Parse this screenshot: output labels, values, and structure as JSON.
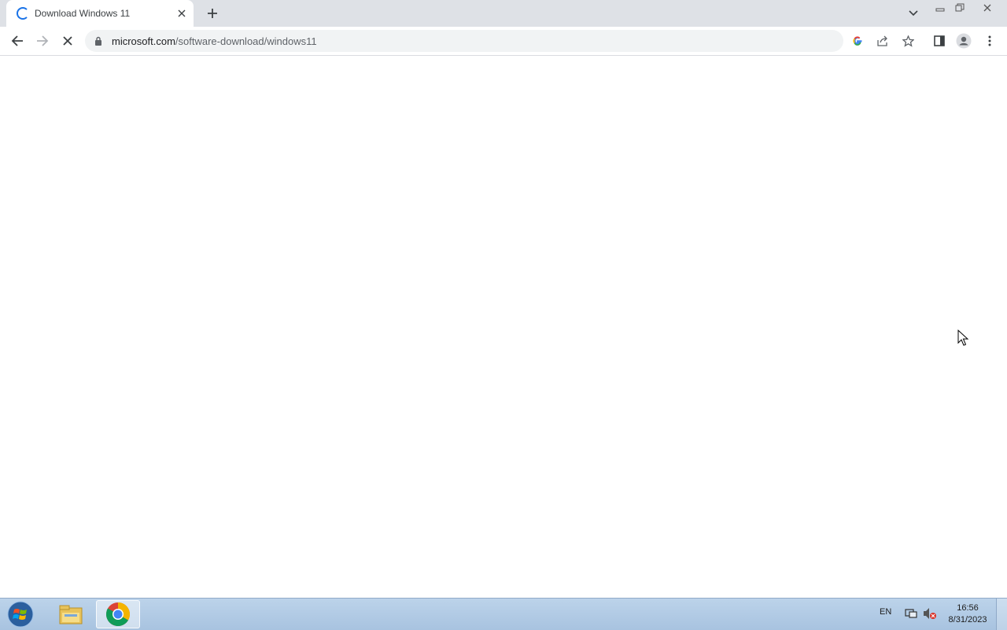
{
  "browser": {
    "tab": {
      "title": "Download Windows 11",
      "loading": true
    },
    "omnibox": {
      "url_host": "microsoft.com",
      "url_path": "/software-download/windows11"
    },
    "icons": {
      "tab_close": "close-icon",
      "new_tab": "plus-icon",
      "tab_search": "chevron-down-icon",
      "back": "arrow-left-icon",
      "forward": "arrow-right-icon",
      "reload": "stop-loading-icon",
      "lock": "lock-icon",
      "google": "google-icon",
      "share": "share-icon",
      "bookmark": "star-icon",
      "side_panel": "side-panel-icon",
      "profile": "profile-icon",
      "menu": "kebab-menu-icon"
    }
  },
  "taskbar": {
    "language": "EN",
    "clock_time": "16:56",
    "clock_date": "8/31/2023",
    "apps": [
      "Windows Explorer",
      "Google Chrome"
    ]
  },
  "colors": {
    "accent": "#1a73e8",
    "tabstrip": "#dee1e6",
    "taskbar": "#b3cbe6"
  }
}
